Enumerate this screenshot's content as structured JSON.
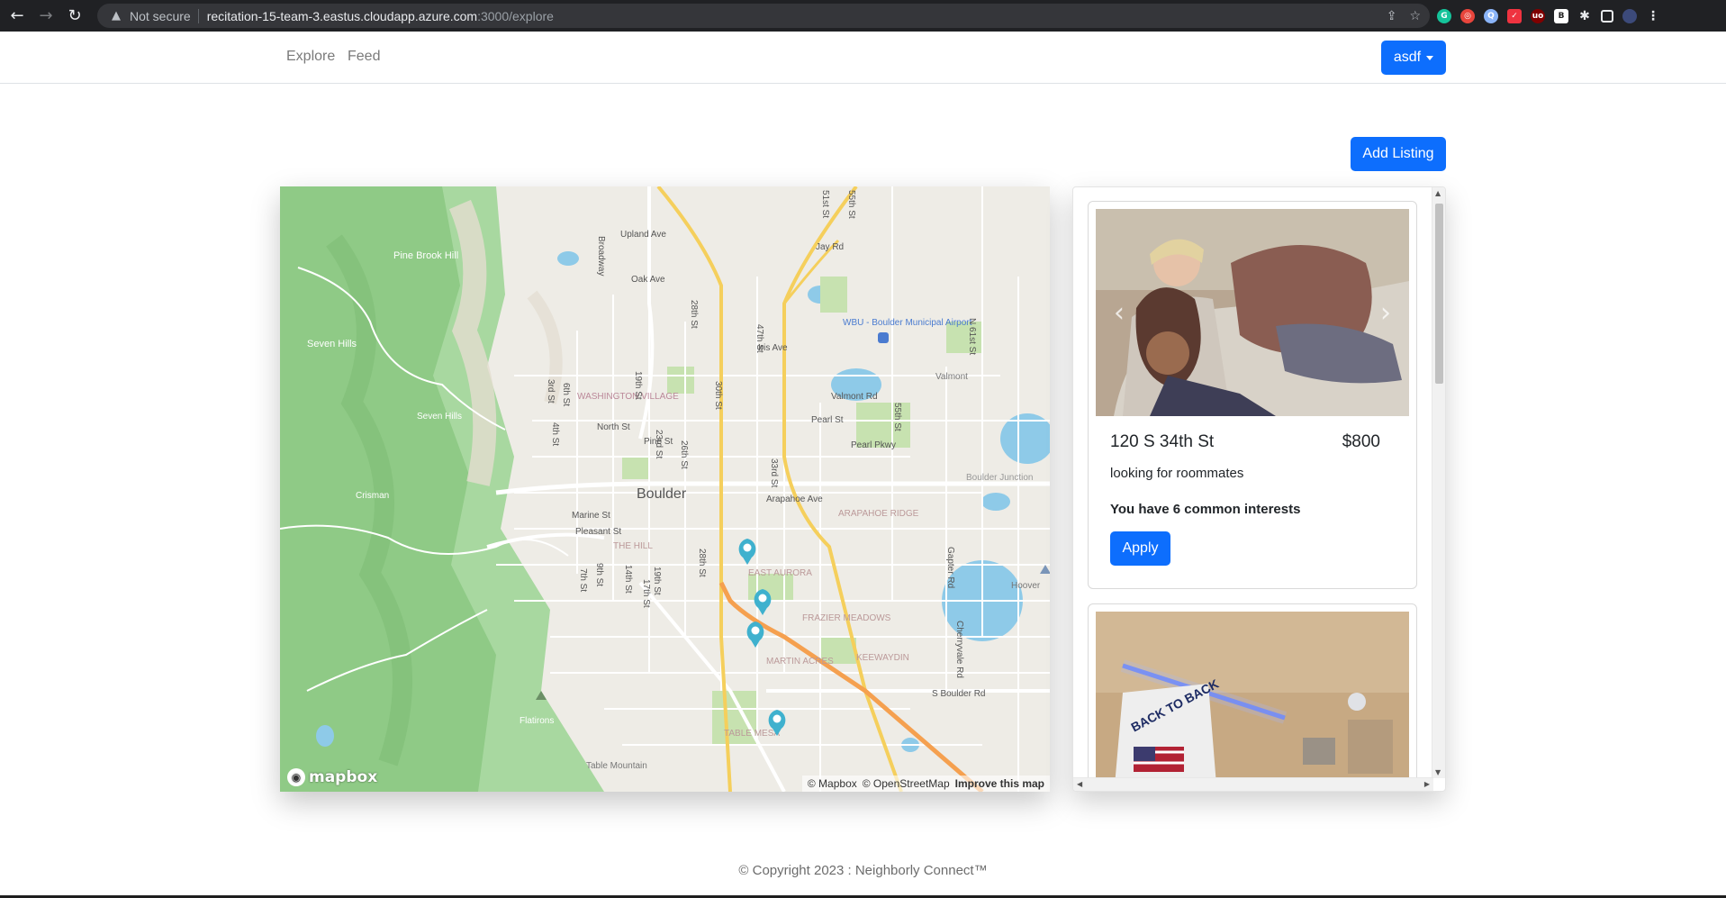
{
  "browser": {
    "security_label": "Not secure",
    "url_host": "recitation-15-team-3.eastus.cloudapp.azure.com",
    "url_path": ":3000/explore"
  },
  "navbar": {
    "links": [
      "Explore",
      "Feed"
    ],
    "user_menu_label": "asdf"
  },
  "add_listing_label": "Add Listing",
  "map": {
    "logo_text": "mapbox",
    "attribution": [
      "© Mapbox",
      "© OpenStreetMap",
      "Improve this map"
    ],
    "labels": [
      "Upland Ave",
      "Jay Rd",
      "Broadway",
      "Oak Ave",
      "28th St",
      "Iris Ave",
      "47th St",
      "WBU - Boulder Municipal Airport",
      "N 61st St",
      "Pine Brook Hill",
      "Seven Hills",
      "WASHINGTON VILLAGE",
      "North St",
      "Valmont Rd",
      "Valmont",
      "Pearl St",
      "Pearl Pkwy",
      "Pine St",
      "Boulder",
      "Arapahoe Ave",
      "ARAPAHOE RIDGE",
      "Boulder Junction",
      "Marine St",
      "Pleasant St",
      "THE HILL",
      "EAST AURORA",
      "FRAZIER MEADOWS",
      "MARTIN ACRES",
      "KEEWAYDIN",
      "S Boulder Rd",
      "Cherryvale Rd",
      "Gapter Rd",
      "Flatirons",
      "Table Mountain",
      "TABLE MESA",
      "Hoover",
      "Crisman",
      "Seven Hills",
      "55th St",
      "51st St",
      "3rd St",
      "4th St",
      "6th St",
      "19th St",
      "23rd St",
      "26th St",
      "30th St",
      "33rd St",
      "7th St",
      "9th St",
      "14th St",
      "17th St",
      "19th St",
      "28th St"
    ]
  },
  "listings": [
    {
      "address": "120 S 34th St",
      "price": "$800",
      "description": "looking for roommates",
      "common_interests": "You have 6 common interests",
      "apply_label": "Apply"
    },
    {
      "flag_text": "BACK TO BACK"
    }
  ],
  "footer": "© Copyright 2023 : Neighborly Connect™"
}
